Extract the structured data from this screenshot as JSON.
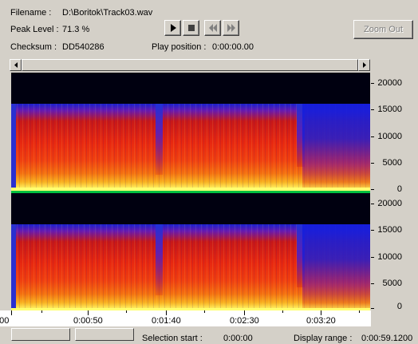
{
  "info": {
    "filename_label": "Filename :",
    "filename_value": "D:\\Boritok\\Track03.wav",
    "peak_label": "Peak Level :",
    "peak_value": "71.3 %",
    "checksum_label": "Checksum :",
    "checksum_value": "DD540286",
    "play_position_label": "Play position :",
    "play_position_value": "0:00:00.00"
  },
  "toolbar": {
    "play_icon": "play-icon",
    "stop_icon": "stop-icon",
    "rewind_icon": "rewind-icon",
    "forward_icon": "fast-forward-icon",
    "zoom_out_label": "Zoom Out"
  },
  "spectrogram": {
    "channels": 2,
    "y_ticks": [
      "20000",
      "15000",
      "10000",
      "5000",
      "0"
    ],
    "colors": {
      "background": "#000010",
      "low": "#ffff70",
      "mid": "#e82810",
      "high": "#1a22d0",
      "separator": "#00c040"
    }
  },
  "timeline": {
    "labels": [
      "0:00",
      "0:00:50",
      "0:01:40",
      "0:02:30",
      "0:03:20"
    ]
  },
  "status": {
    "selection_label": "Selection start :",
    "selection_value": "0:00:00",
    "display_label": "Display range :",
    "display_value": "0:00:59.1200"
  }
}
